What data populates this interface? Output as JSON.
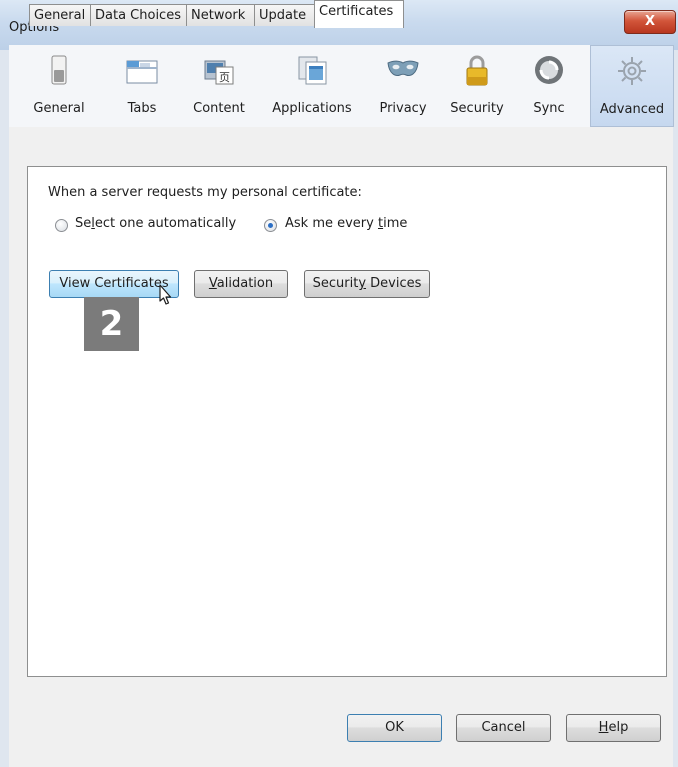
{
  "window": {
    "title": "Options",
    "close_label": "X"
  },
  "toolbar": {
    "items": [
      {
        "label": "General",
        "icon": "switch-icon"
      },
      {
        "label": "Tabs",
        "icon": "tabs-window-icon"
      },
      {
        "label": "Content",
        "icon": "content-page-icon"
      },
      {
        "label": "Applications",
        "icon": "applications-icon"
      },
      {
        "label": "Privacy",
        "icon": "mask-icon"
      },
      {
        "label": "Security",
        "icon": "padlock-icon"
      },
      {
        "label": "Sync",
        "icon": "sync-icon"
      },
      {
        "label": "Advanced",
        "icon": "gear-icon",
        "selected": true
      }
    ]
  },
  "tabs": [
    {
      "label": "General"
    },
    {
      "label": "Data Choices"
    },
    {
      "label": "Network"
    },
    {
      "label": "Update"
    },
    {
      "label": "Certificates",
      "selected": true
    }
  ],
  "certificates": {
    "prompt": "When a server requests my personal certificate:",
    "option_auto_pre": "Se",
    "option_auto_key": "l",
    "option_auto_post": "ect one automatically",
    "option_ask_pre": "Ask me every ",
    "option_ask_key": "t",
    "option_ask_post": "ime",
    "selected_option": "Ask me every time"
  },
  "buttons": {
    "view_certificates": "View Certificates",
    "validation_key": "V",
    "validation_rest": "alidation",
    "security_devices_pre": "Securit",
    "security_devices_key": "y",
    "security_devices_post": " Devices"
  },
  "annotation": {
    "step_number": "2"
  },
  "footer": {
    "ok": "OK",
    "cancel": "Cancel",
    "help_key": "H",
    "help_rest": "elp"
  },
  "colors": {
    "accent": "#2c6fc5",
    "step_badge": "#7b7b7b",
    "close_button": "#c8452c"
  }
}
